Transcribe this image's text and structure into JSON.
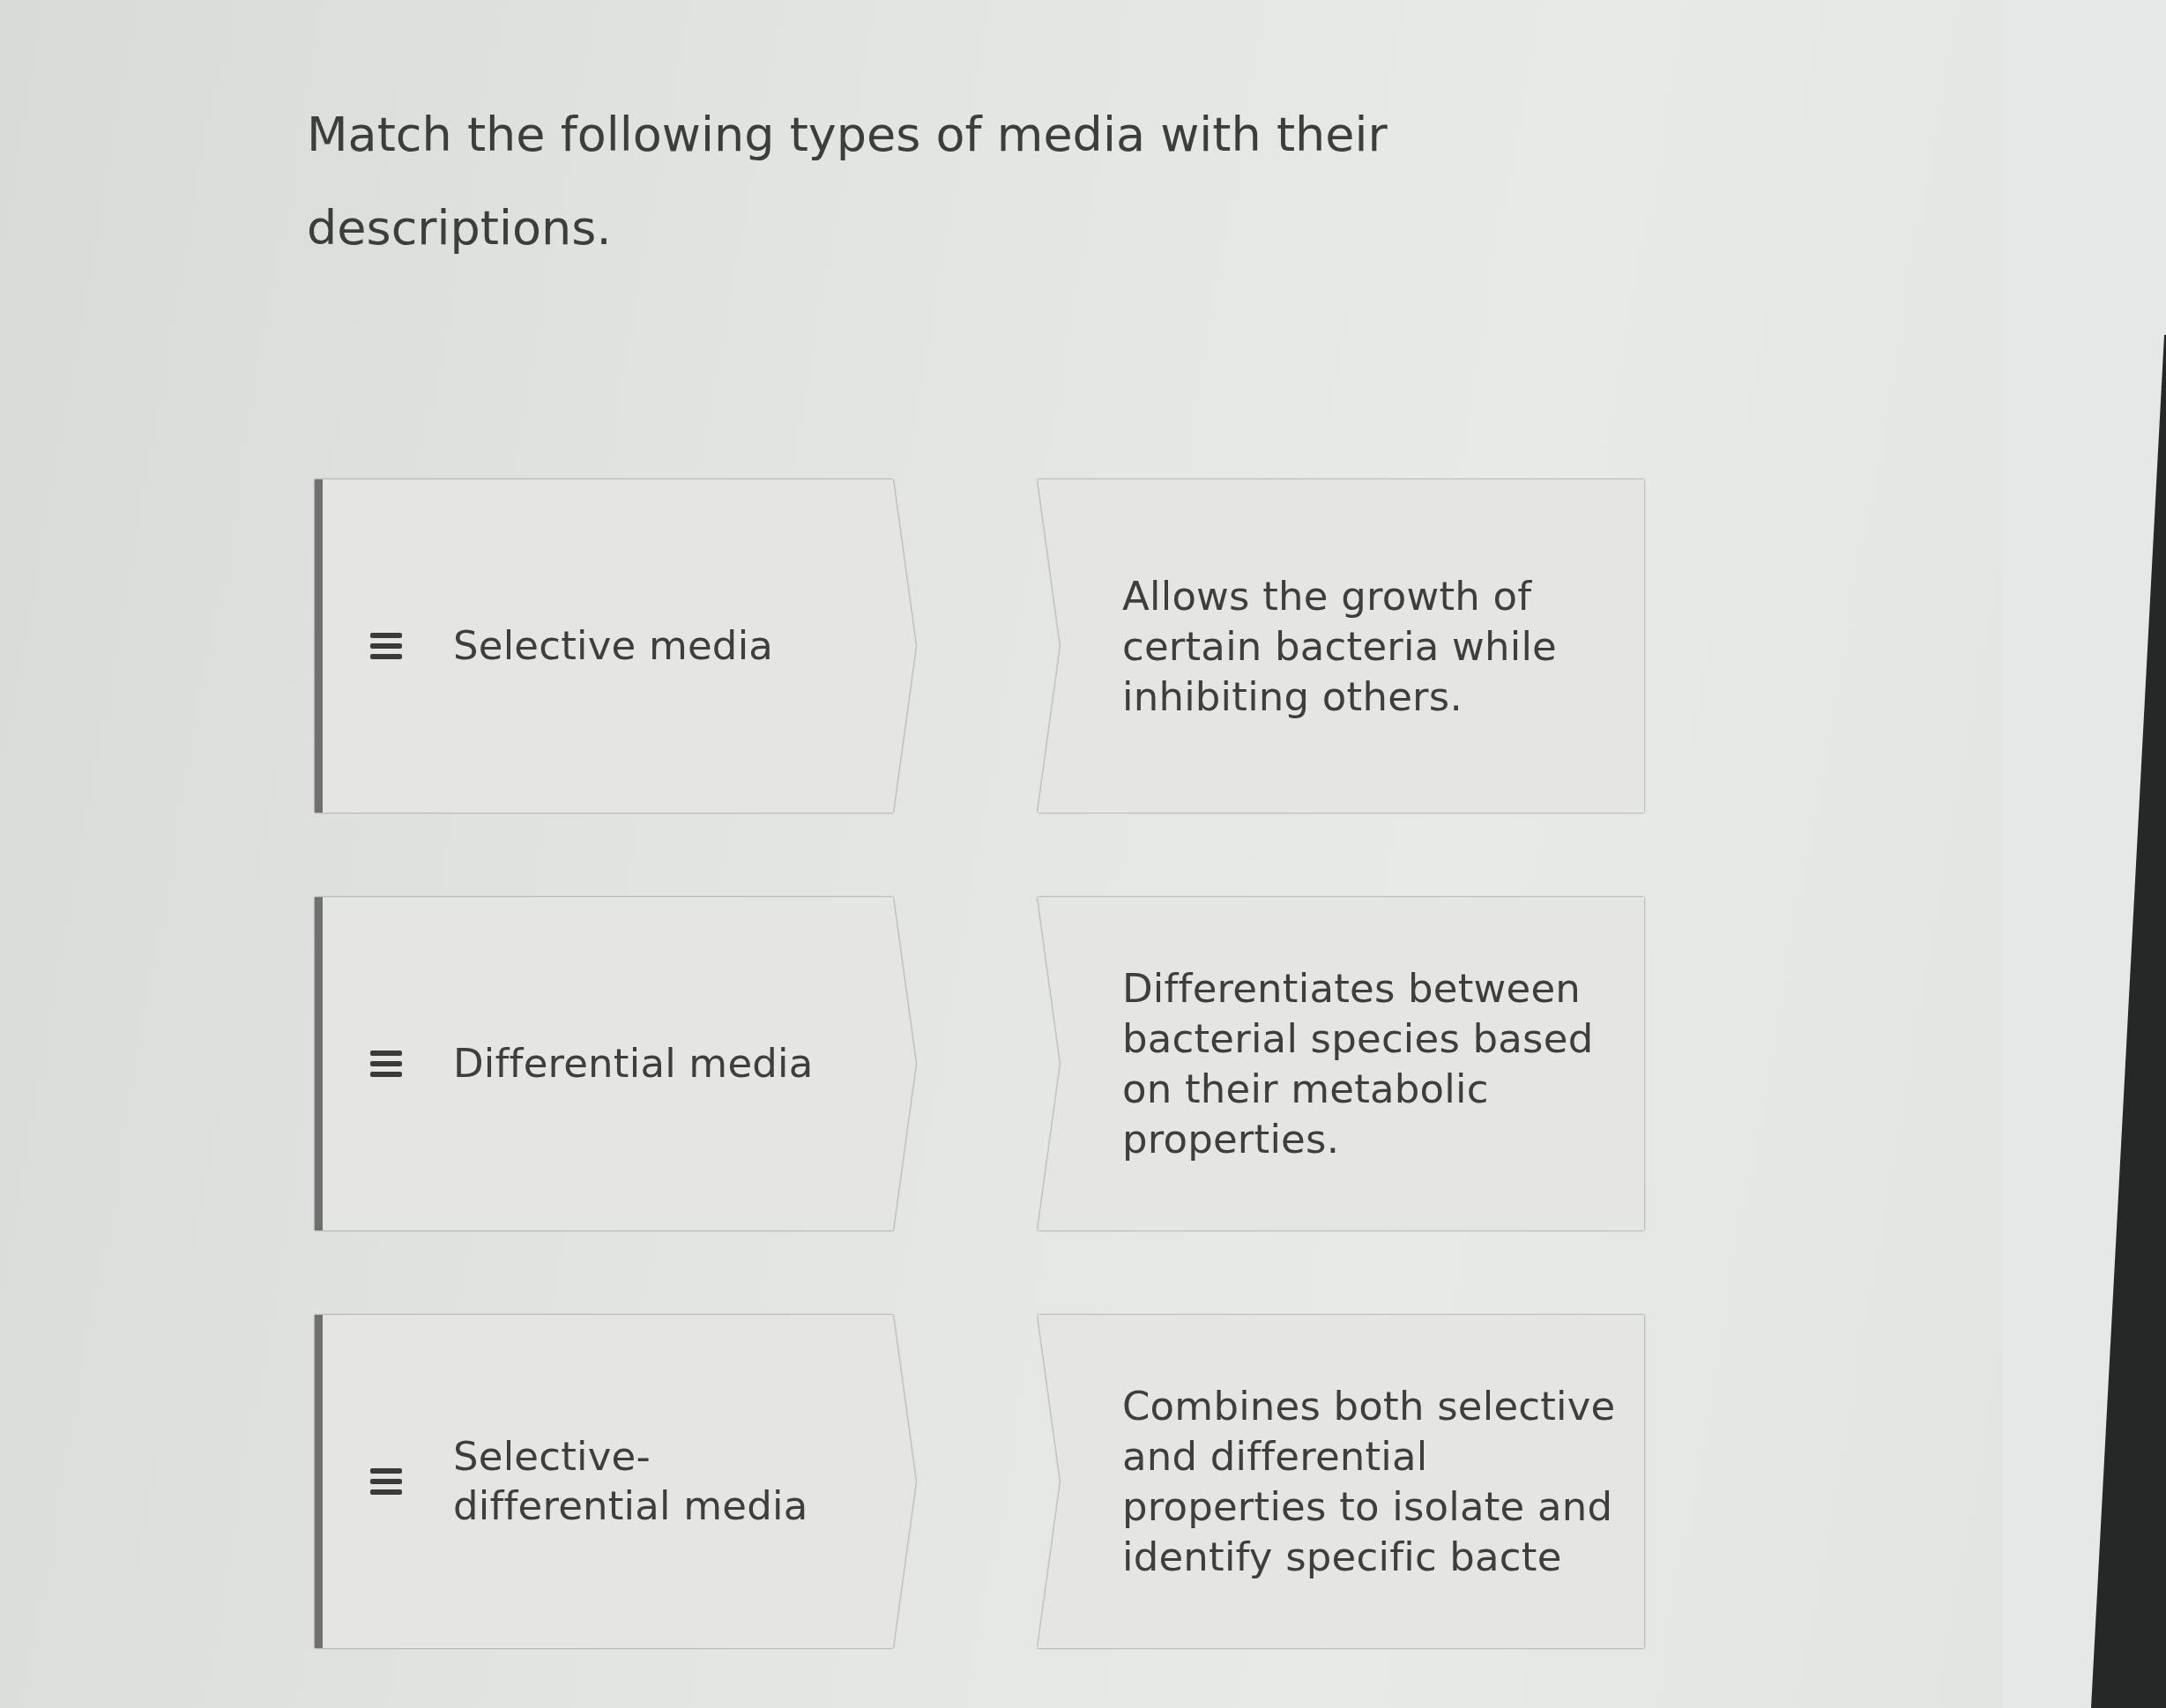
{
  "question": "Match the following types of media with their descriptions.",
  "pairs": [
    {
      "term": "Selective media",
      "description": "Allows the growth of certain bacteria while inhibiting others."
    },
    {
      "term": "Differential media",
      "description": "Differentiates between bacterial species based on their metabolic properties."
    },
    {
      "term": "Selective-differential media",
      "description": "Combines both selective and differential properties to isolate and identify specific bacte"
    }
  ]
}
